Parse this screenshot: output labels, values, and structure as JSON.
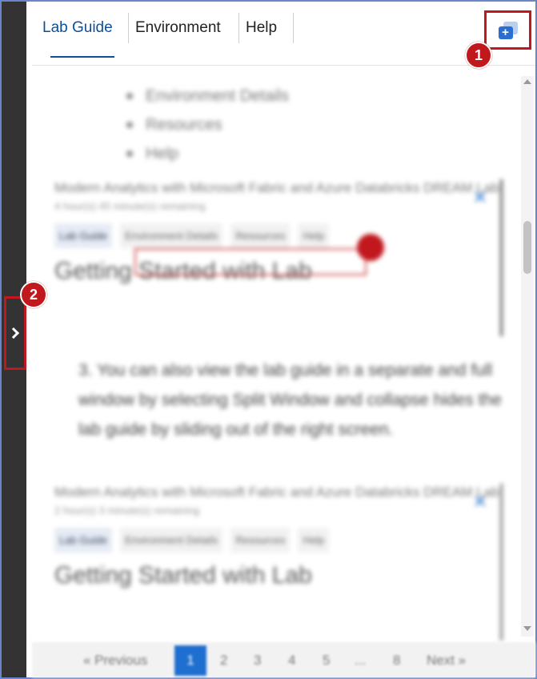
{
  "tabs": {
    "lab_guide": "Lab Guide",
    "environment": "Environment",
    "help": "Help"
  },
  "badges": {
    "one": "1",
    "two": "2"
  },
  "content": {
    "bullets": [
      "Environment Details",
      "Resources",
      "Help"
    ],
    "screenshot_1": {
      "title": "Modern Analytics with Microsoft Fabric and Azure Databricks DREAM Lab",
      "subtitle": "4 hour(s) 45 minute(s) remaining",
      "tabs": [
        "Lab Guide",
        "Environment Details",
        "Resources",
        "Help"
      ],
      "heading": "Getting Started with Lab"
    },
    "step_3": "3. You can also view the lab guide in a separate and full window by selecting Split Window and collapse hides the lab guide by sliding out of the right screen.",
    "screenshot_2": {
      "title": "Modern Analytics with Microsoft Fabric and Azure Databricks DREAM Lab",
      "subtitle": "2 hour(s) 3 minute(s) remaining",
      "tabs": [
        "Lab Guide",
        "Environment Details",
        "Resources",
        "Help"
      ],
      "heading": "Getting Started with Lab"
    }
  },
  "pager": {
    "previous": "« Previous",
    "pages": [
      "1",
      "2",
      "3",
      "4",
      "5",
      "...",
      "8"
    ],
    "next": "Next »"
  },
  "colors": {
    "accent": "#0e4f9a",
    "callout_red": "#c0181d",
    "rail": "#333333"
  },
  "icons": {
    "split_window": "split-window-icon",
    "collapse": "chevron-right-icon"
  }
}
